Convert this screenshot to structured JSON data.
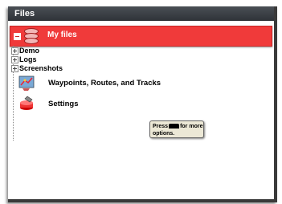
{
  "window": {
    "title": "Files"
  },
  "tree": {
    "root": {
      "label": "My files"
    },
    "folders": [
      {
        "label": "Demo"
      },
      {
        "label": "Logs"
      },
      {
        "label": "Screenshots"
      }
    ],
    "items": [
      {
        "label": "Waypoints, Routes, and Tracks",
        "icon": "waypoints-icon"
      },
      {
        "label": "Settings",
        "icon": "settings-icon"
      }
    ]
  },
  "tooltip": {
    "prefix": "Press",
    "suffix": "for more",
    "line2": "options."
  },
  "colors": {
    "selection": "#f03a3a",
    "titlebar": "#3a3f45",
    "tooltip_bg": "#ece8d6"
  }
}
